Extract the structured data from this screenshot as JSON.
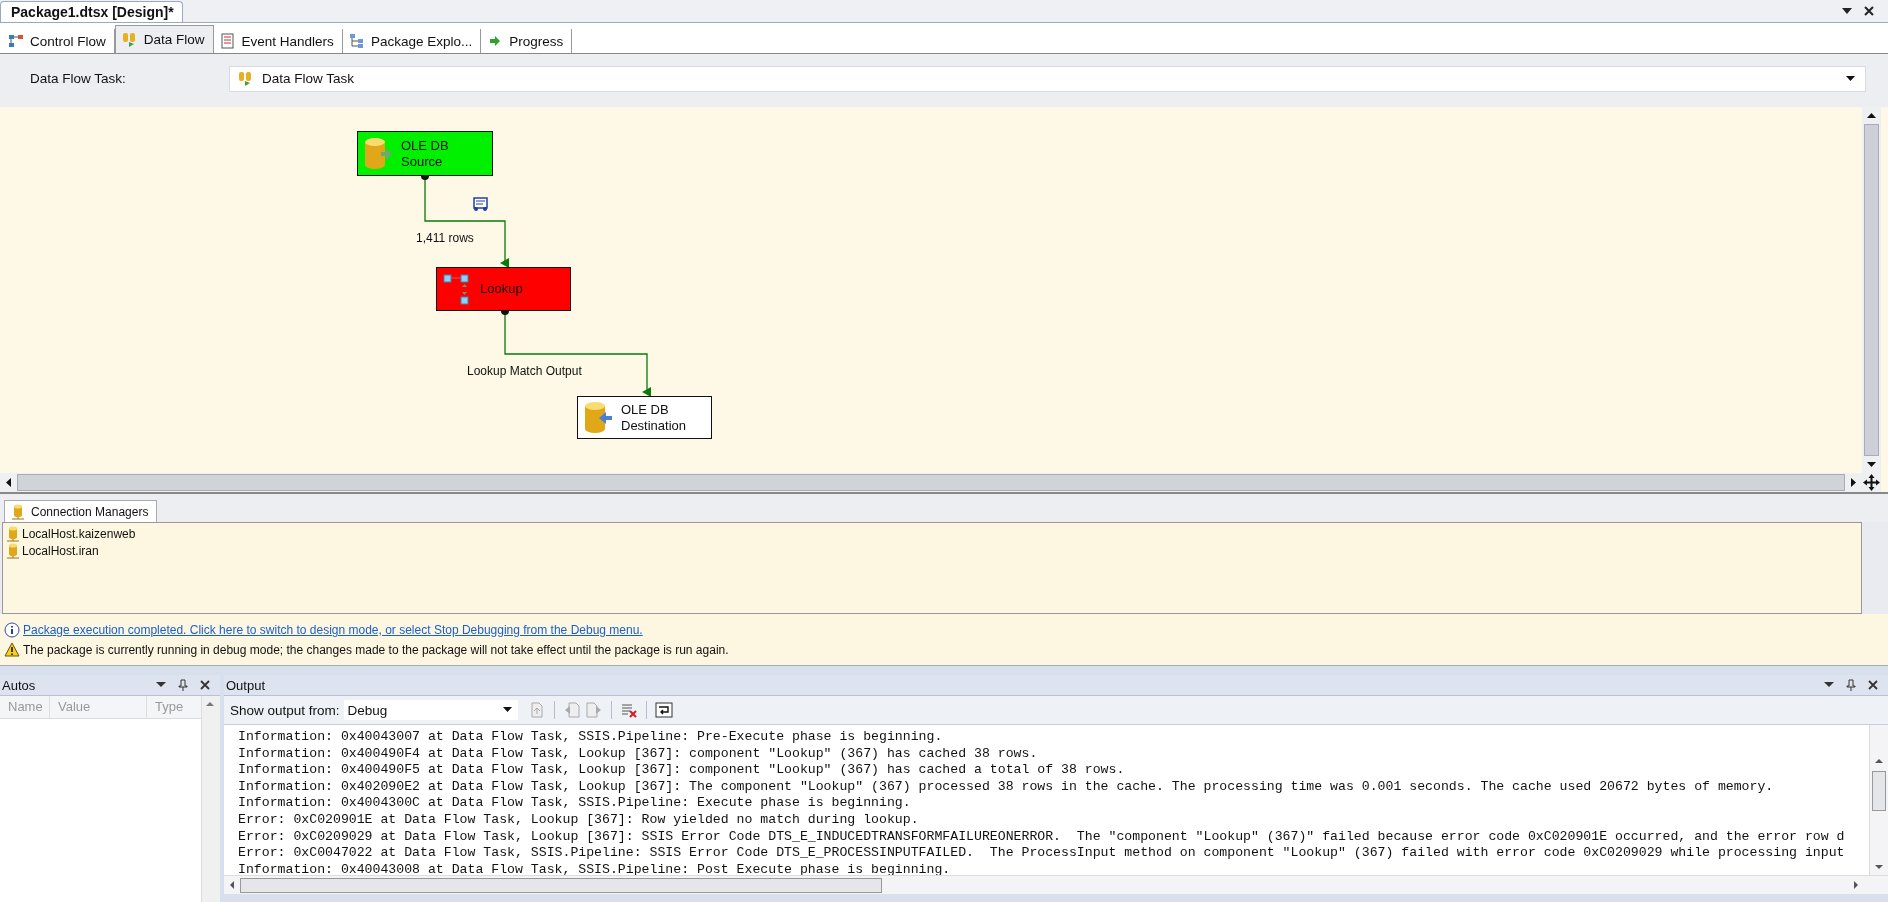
{
  "document_tab": {
    "title": "Package1.dtsx [Design]*"
  },
  "designer_tabs": [
    {
      "label": "Control Flow",
      "kind": "control",
      "selected": false
    },
    {
      "label": "Data Flow",
      "kind": "dataflow",
      "selected": true
    },
    {
      "label": "Event Handlers",
      "kind": "events",
      "selected": false
    },
    {
      "label": "Package Explo...",
      "kind": "explorer",
      "selected": false
    },
    {
      "label": "Progress",
      "kind": "progress",
      "selected": false
    }
  ],
  "task_selector": {
    "label": "Data Flow Task:",
    "value": "Data Flow Task"
  },
  "canvas": {
    "components": [
      {
        "name": "OLE DB Source",
        "kind": "source",
        "color": "#00f000"
      },
      {
        "name": "Lookup",
        "kind": "lookup",
        "color": "#ff0000"
      },
      {
        "name": "OLE DB Destination",
        "kind": "destination",
        "color": "#ffffff"
      }
    ],
    "paths": [
      {
        "label": "1,411 rows",
        "data_viewer": true
      },
      {
        "label": "Lookup Match Output",
        "data_viewer": false
      }
    ]
  },
  "connection_managers": {
    "tab": "Connection Managers",
    "items": [
      "LocalHost.kaizenweb",
      "LocalHost.iran"
    ]
  },
  "messages": [
    {
      "kind": "info",
      "text": "Package execution completed. Click here to switch to design mode, or select Stop Debugging from the Debug menu."
    },
    {
      "kind": "warning",
      "text": "The package is currently running in debug mode; the changes made to the package will not take effect until the package is run again."
    }
  ],
  "autos": {
    "title": "Autos",
    "columns": [
      "Name",
      "Value",
      "Type"
    ]
  },
  "output": {
    "title": "Output",
    "show_from_label": "Show output from:",
    "source": "Debug",
    "lines": [
      "Information: 0x40043007 at Data Flow Task, SSIS.Pipeline: Pre-Execute phase is beginning.",
      "Information: 0x400490F4 at Data Flow Task, Lookup [367]: component \"Lookup\" (367) has cached 38 rows.",
      "Information: 0x400490F5 at Data Flow Task, Lookup [367]: component \"Lookup\" (367) has cached a total of 38 rows.",
      "Information: 0x402090E2 at Data Flow Task, Lookup [367]: The component \"Lookup\" (367) processed 38 rows in the cache. The processing time was 0.001 seconds. The cache used 20672 bytes of memory.",
      "Information: 0x4004300C at Data Flow Task, SSIS.Pipeline: Execute phase is beginning.",
      "Error: 0xC020901E at Data Flow Task, Lookup [367]: Row yielded no match during lookup.",
      "Error: 0xC0209029 at Data Flow Task, Lookup [367]: SSIS Error Code DTS_E_INDUCEDTRANSFORMFAILUREONERROR.  The \"component \"Lookup\" (367)\" failed because error code 0xC020901E occurred, and the error row d",
      "Error: 0xC0047022 at Data Flow Task, SSIS.Pipeline: SSIS Error Code DTS_E_PROCESSINPUTFAILED.  The ProcessInput method on component \"Lookup\" (367) failed with error code 0xC0209029 while processing input",
      "Information: 0x40043008 at Data Flow Task, SSIS.Pipeline: Post Execute phase is beginning."
    ]
  }
}
